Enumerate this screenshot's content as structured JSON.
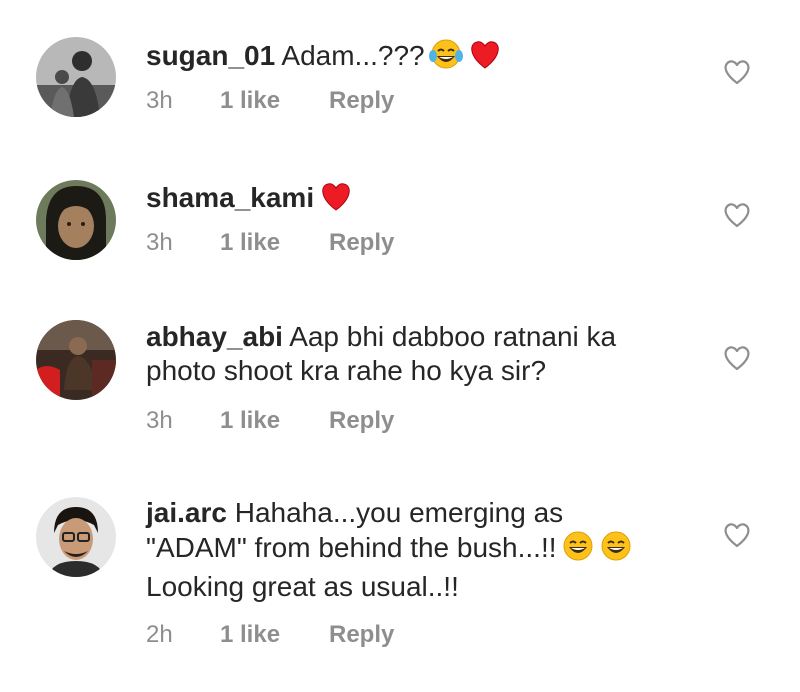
{
  "comments": [
    {
      "username": "sugan_01",
      "text": "Adam...???",
      "emojis": [
        "face-with-tears-of-joy",
        "red-heart"
      ],
      "time": "3h",
      "likes": "1 like",
      "reply": "Reply"
    },
    {
      "username": "shama_kami",
      "text": "",
      "emojis": [
        "red-heart"
      ],
      "time": "3h",
      "likes": "1 like",
      "reply": "Reply"
    },
    {
      "username": "abhay_abi",
      "text_line1": "Aap bhi dabboo ratnani ka",
      "text_line2": "photo shoot kra rahe ho kya sir?",
      "time": "3h",
      "likes": "1 like",
      "reply": "Reply"
    },
    {
      "username": "jai.arc",
      "text_line1": "Hahaha...you emerging as",
      "text_line2": "\"ADAM\" from behind the bush...!!",
      "text_line3": "Looking great as usual..!!",
      "emojis": [
        "grinning-face-with-smiling-eyes",
        "grinning-face-with-smiling-eyes"
      ],
      "time": "2h",
      "likes": "1 like",
      "reply": "Reply"
    }
  ],
  "colors": {
    "text": "#262626",
    "meta": "#8e8e8e",
    "heart_outline": "#8e8e8e",
    "emoji_heart": "#ed1c24"
  },
  "icons": {
    "like": "heart-outline-icon"
  }
}
